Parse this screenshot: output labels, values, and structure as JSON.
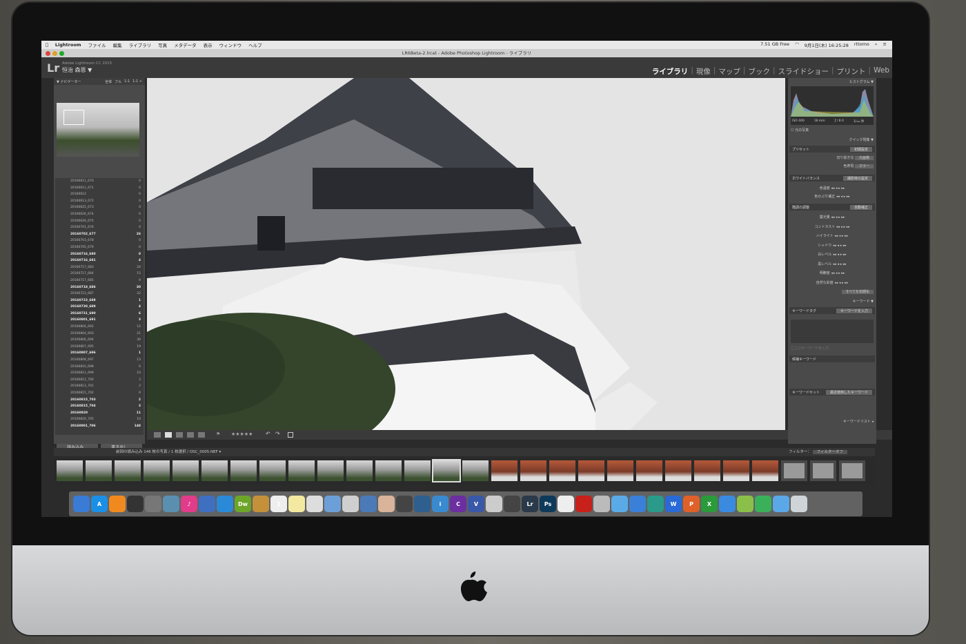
{
  "menubar": {
    "app": "Lightroom",
    "items": [
      "ファイル",
      "編集",
      "ライブラリ",
      "写真",
      "メタデータ",
      "表示",
      "ウィンドウ",
      "ヘルプ"
    ],
    "disk_free": "7.51 GB Free",
    "datetime": "9月1日(木) 16:25:28",
    "user": "rttomo"
  },
  "window": {
    "title": "LR6Beta-2.lrcat - Adobe Photoshop Lightroom - ライブラリ"
  },
  "lr_header": {
    "logo": "Lr",
    "product": "Adobe Lightroom CC 2015",
    "identity": "恒治 森恩 ▼",
    "modules": [
      "ライブラリ",
      "現像",
      "マップ",
      "ブック",
      "スライドショー",
      "プリント",
      "Web"
    ],
    "active_module": "ライブラリ"
  },
  "left_panel": {
    "navigator_label": "ナビゲーター",
    "navigator_zoom": [
      "全体",
      "フル",
      "1:1",
      "1:1 ÷"
    ],
    "folders": [
      {
        "name": "20160611_670",
        "count": "0"
      },
      {
        "name": "20160611_671",
        "count": "0"
      },
      {
        "name": "20160612",
        "count": "0"
      },
      {
        "name": "20160613_672",
        "count": "0"
      },
      {
        "name": "20160625_673",
        "count": "0"
      },
      {
        "name": "20160626_674",
        "count": "0"
      },
      {
        "name": "20160626_675",
        "count": "0"
      },
      {
        "name": "20160701_676",
        "count": "0"
      },
      {
        "name": "20160702_677",
        "count": "26",
        "bold": true
      },
      {
        "name": "20160703_678",
        "count": "0"
      },
      {
        "name": "20160705_679",
        "count": "0"
      },
      {
        "name": "20160716_680",
        "count": "0",
        "bold": true
      },
      {
        "name": "20160716_681",
        "count": "4",
        "bold": true
      },
      {
        "name": "20160717_683",
        "count": "24"
      },
      {
        "name": "20160717_684",
        "count": "15"
      },
      {
        "name": "20160717_685",
        "count": "9"
      },
      {
        "name": "20160718_686",
        "count": "30",
        "bold": true
      },
      {
        "name": "20160723_687",
        "count": "22"
      },
      {
        "name": "20160723_688",
        "count": "1",
        "bold": true
      },
      {
        "name": "20160730_689",
        "count": "4",
        "bold": true
      },
      {
        "name": "20160731_690",
        "count": "6",
        "bold": true
      },
      {
        "name": "20160801_691",
        "count": "3",
        "bold": true
      },
      {
        "name": "20160804_692",
        "count": "12"
      },
      {
        "name": "20160804_693",
        "count": "21"
      },
      {
        "name": "20160806_694",
        "count": "30"
      },
      {
        "name": "20160807_695",
        "count": "19"
      },
      {
        "name": "20160807_696",
        "count": "1",
        "bold": true
      },
      {
        "name": "20160808_697",
        "count": "13"
      },
      {
        "name": "20160810_698",
        "count": "0"
      },
      {
        "name": "20160811_699",
        "count": "23"
      },
      {
        "name": "20160812_700",
        "count": "3"
      },
      {
        "name": "20160813_701",
        "count": "2"
      },
      {
        "name": "20160815_702",
        "count": "0"
      },
      {
        "name": "20160815_703",
        "count": "2",
        "bold": true
      },
      {
        "name": "20160815_704",
        "count": "3",
        "bold": true
      },
      {
        "name": "20160820",
        "count": "11",
        "bold": true
      },
      {
        "name": "20160820_705",
        "count": "10"
      },
      {
        "name": "20160901_706",
        "count": "148",
        "bold": true
      }
    ],
    "import_button": "読み込み...",
    "export_button": "書き出し..."
  },
  "right_panel": {
    "histogram_label": "ヒストグラム",
    "exif": [
      "ISO 400",
      "18 mm",
      "ƒ / 8.0",
      "1/₁₆₀ 秒"
    ],
    "original_photo": "元の写真",
    "quick_develop_label": "クイック現像",
    "preset_label": "プリセット",
    "preset_value": "初期設定",
    "crop_label": "切り抜き比",
    "crop_value": "元画像",
    "treatment_label": "色表現",
    "treatment_value": "カラー",
    "wb_label": "ホワイトバランス",
    "wb_value": "撮影時の設定",
    "temp_label": "色温度",
    "tint_label": "色かぶり補正",
    "tone_label": "階調の調整",
    "tone_value": "自動補正",
    "tone_rows": [
      "露光量",
      "コントラスト",
      "ハイライト",
      "シャドウ",
      "白レベル",
      "黒レベル",
      "明瞭度",
      "自然な彩度"
    ],
    "reset_all": "すべてを初期化",
    "keyword_label": "キーワード",
    "keyword_tags_label": "キーワードタグ",
    "keyword_tags_value": "キーワードを入力",
    "keyword_placeholder": "ここにキーワードを入力",
    "suggested_label": "候補キーワード",
    "keyword_set_label": "キーワードセット",
    "keyword_set_value": "最近使用したキーワード",
    "keyword_list_label": "キーワードリスト"
  },
  "toolbar": {
    "stars": "★★★★★"
  },
  "filmstrip": {
    "source_info": "前回の読み込み  146 枚の写真 / 1 枚選択 / DSC_0005.NEF ▾",
    "filter_label": "フィルター：",
    "filter_value": "フィルターオフ"
  },
  "dock": {
    "apps": [
      {
        "icon": "finder-icon",
        "label": "",
        "color": "#3a7bd5"
      },
      {
        "icon": "app-store-icon",
        "label": "A",
        "color": "#1b8fe6"
      },
      {
        "icon": "ibooks-icon",
        "label": "",
        "color": "#f08a1e"
      },
      {
        "icon": "dashboard-icon",
        "label": "",
        "color": "#333333"
      },
      {
        "icon": "system-preferences-icon",
        "label": "",
        "color": "#777777"
      },
      {
        "icon": "preview-icon",
        "label": "",
        "color": "#5a8fb0"
      },
      {
        "icon": "itunes-icon",
        "label": "♪",
        "color": "#e03c8a"
      },
      {
        "icon": "iphoto-icon",
        "label": "",
        "color": "#3f6fc0"
      },
      {
        "icon": "safari-icon",
        "label": "",
        "color": "#2a8ad8"
      },
      {
        "icon": "dreamweaver-icon",
        "label": "Dw",
        "color": "#6da528"
      },
      {
        "icon": "notes-icon",
        "label": "",
        "color": "#c4913a"
      },
      {
        "icon": "calendar-icon",
        "label": "1",
        "color": "#eeeeee"
      },
      {
        "icon": "stickies-icon",
        "label": "",
        "color": "#f3e9a0"
      },
      {
        "icon": "textedit-icon",
        "label": "",
        "color": "#dddddd"
      },
      {
        "icon": "pages-icon",
        "label": "",
        "color": "#6c9fd8"
      },
      {
        "icon": "keynote-icon",
        "label": "",
        "color": "#cfcfcf"
      },
      {
        "icon": "image-viewer-icon",
        "label": "",
        "color": "#4a7ab8"
      },
      {
        "icon": "face-app-icon",
        "label": "",
        "color": "#d9b39a"
      },
      {
        "icon": "disk-utility-icon",
        "label": "",
        "color": "#444444"
      },
      {
        "icon": "time-machine-icon",
        "label": "",
        "color": "#2f5f8f"
      },
      {
        "icon": "info-icon",
        "label": "i",
        "color": "#3a8ad0"
      },
      {
        "icon": "capture-nx-icon",
        "label": "C",
        "color": "#6b2fa0"
      },
      {
        "icon": "viewnx-icon",
        "label": "V",
        "color": "#3a58a8"
      },
      {
        "icon": "camera-control-icon",
        "label": "",
        "color": "#cccccc"
      },
      {
        "icon": "nikon-transfer-icon",
        "label": "",
        "color": "#444444"
      },
      {
        "icon": "lightroom-icon",
        "label": "Lr",
        "color": "#2b3a4a"
      },
      {
        "icon": "photoshop-icon",
        "label": "Ps",
        "color": "#0e3a5a"
      },
      {
        "icon": "document-icon",
        "label": "",
        "color": "#eeeeee"
      },
      {
        "icon": "acrobat-icon",
        "label": "",
        "color": "#c8201a"
      },
      {
        "icon": "dvd-player-icon",
        "label": "",
        "color": "#bbbbbb"
      },
      {
        "icon": "messages-icon",
        "label": "",
        "color": "#5aaae8"
      },
      {
        "icon": "chrome-icon",
        "label": "",
        "color": "#3a80d8"
      },
      {
        "icon": "clock-icon",
        "label": "",
        "color": "#2a9a8a"
      },
      {
        "icon": "word-icon",
        "label": "W",
        "color": "#2a6ad8"
      },
      {
        "icon": "powerpoint-icon",
        "label": "P",
        "color": "#e0602a"
      },
      {
        "icon": "excel-icon",
        "label": "X",
        "color": "#2a9a3a"
      },
      {
        "icon": "network-icon",
        "label": "",
        "color": "#3a8ae0"
      },
      {
        "icon": "migration-icon",
        "label": "",
        "color": "#8ac04a"
      },
      {
        "icon": "facetime-icon",
        "label": "",
        "color": "#3ab05a"
      },
      {
        "icon": "downloads-folder-icon",
        "label": "",
        "color": "#5aa8e8"
      },
      {
        "icon": "trash-icon",
        "label": "",
        "color": "#cfd4d8"
      }
    ]
  }
}
